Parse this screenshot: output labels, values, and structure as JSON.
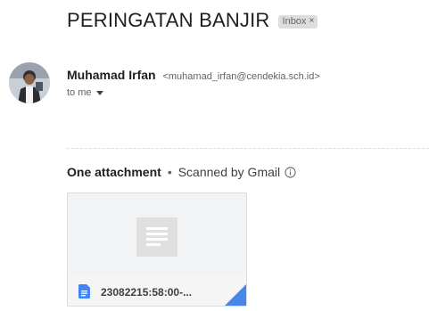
{
  "email": {
    "subject": "PERINGATAN BANJIR",
    "label": "Inbox",
    "label_remove": "×",
    "sender": {
      "name": "Muhamad Irfan",
      "email": "<muhamad_irfan@cendekia.sch.id>",
      "recipient_text": "to me"
    }
  },
  "attachments": {
    "count_label": "One attachment",
    "separator": "•",
    "scan_text": "Scanned by Gmail",
    "info_icon": "info-icon",
    "items": [
      {
        "file_name": "23082215:58:00-...",
        "icon": "doc-file-icon",
        "icon_color": "#4285f4"
      }
    ]
  },
  "colors": {
    "label_bg": "#dddddd",
    "doc_blue": "#4285f4",
    "fold_blue": "#4a86e8"
  }
}
